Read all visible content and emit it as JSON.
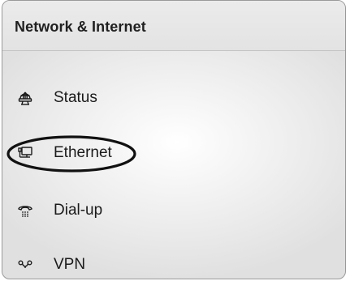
{
  "window": {
    "title": "Network & Internet"
  },
  "nav": {
    "items": [
      {
        "label": "Status",
        "icon": "globe-icon"
      },
      {
        "label": "Ethernet",
        "icon": "ethernet-monitor-icon"
      },
      {
        "label": "Dial-up",
        "icon": "phone-icon"
      },
      {
        "label": "VPN",
        "icon": "vpn-link-icon"
      }
    ]
  },
  "colors": {
    "text": "#1b1b1b",
    "annotation_stroke": "#111111"
  }
}
